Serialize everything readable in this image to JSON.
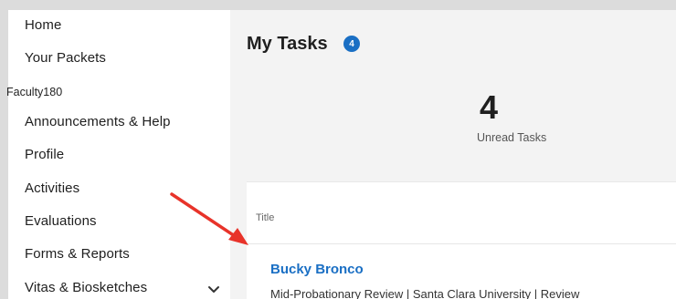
{
  "sidebar": {
    "items_top": [
      {
        "label": "Home"
      },
      {
        "label": "Your Packets"
      }
    ],
    "section_label": "Faculty180",
    "items": [
      {
        "label": "Announcements & Help"
      },
      {
        "label": "Profile"
      },
      {
        "label": "Activities"
      },
      {
        "label": "Evaluations"
      },
      {
        "label": "Forms & Reports"
      },
      {
        "label": "Vitas & Biosketches"
      }
    ]
  },
  "main": {
    "title": "My Tasks",
    "badge_count": "4",
    "stat": {
      "value": "4",
      "label": "Unread Tasks"
    },
    "table": {
      "column_header": "Title",
      "rows": [
        {
          "title": "Bucky Bronco",
          "meta": "Mid-Probationary Review | Santa Clara University | Review"
        }
      ]
    }
  },
  "colors": {
    "accent": "#1a6fc4",
    "annotation": "#e8332a",
    "background": "#f3f3f3"
  },
  "icons": {
    "expand": "chevron-down-icon",
    "annotation": "red-arrow-icon"
  }
}
